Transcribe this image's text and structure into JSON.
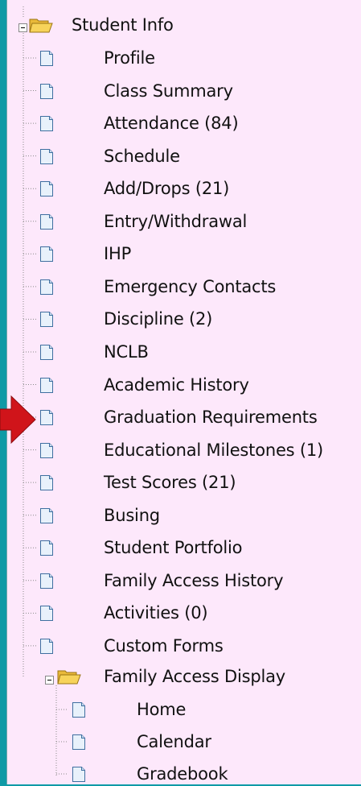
{
  "tree": {
    "root": {
      "label": "Student Info",
      "icon": "folder-open-icon",
      "expanded": true
    },
    "items": [
      {
        "label": "Profile"
      },
      {
        "label": "Class Summary"
      },
      {
        "label": "Attendance (84)"
      },
      {
        "label": "Schedule"
      },
      {
        "label": "Add/Drops (21)"
      },
      {
        "label": "Entry/Withdrawal"
      },
      {
        "label": "IHP"
      },
      {
        "label": "Emergency Contacts"
      },
      {
        "label": "Discipline (2)"
      },
      {
        "label": "NCLB"
      },
      {
        "label": "Academic History"
      },
      {
        "label": "Graduation Requirements"
      },
      {
        "label": "Educational Milestones (1)"
      },
      {
        "label": "Test Scores (21)"
      },
      {
        "label": "Busing"
      },
      {
        "label": "Student Portfolio"
      },
      {
        "label": "Family Access History"
      },
      {
        "label": "Activities (0)"
      },
      {
        "label": "Custom Forms"
      }
    ],
    "subfolder": {
      "label": "Family Access Display",
      "icon": "folder-open-icon",
      "expanded": true,
      "items": [
        {
          "label": "Home"
        },
        {
          "label": "Calendar"
        },
        {
          "label": "Gradebook"
        }
      ]
    }
  },
  "colors": {
    "panel_background": "#fde8fb",
    "frame_background": "#0f9aa6",
    "pointer_arrow": "#d0141a",
    "folder_fill": "#f7d35a",
    "doc_fill": "#e8f1fb"
  }
}
